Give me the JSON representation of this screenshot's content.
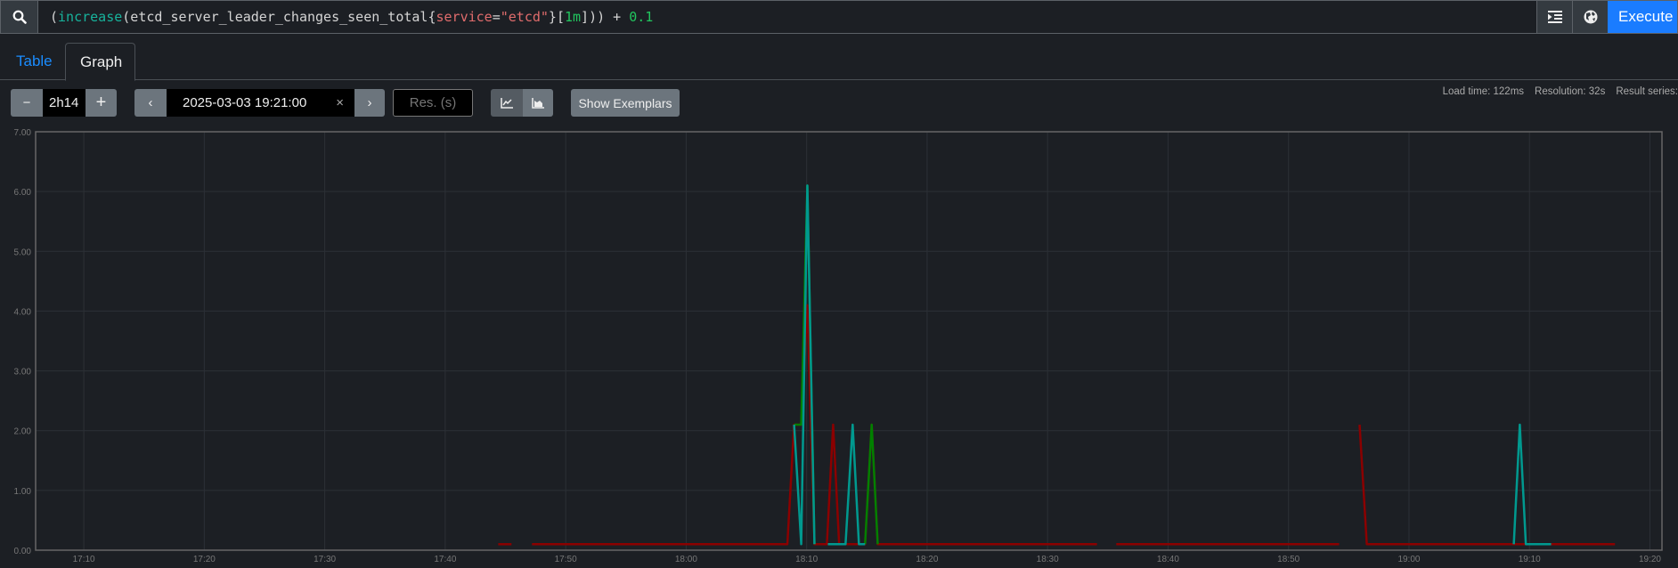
{
  "query": {
    "open": "(",
    "fn": "increase",
    "metric": "(etcd_server_leader_changes_seen_total{",
    "label_key": "service",
    "eq": "=",
    "label_val": "\"etcd\"",
    "close_brace": "}[",
    "range": "1m",
    "tail": "])) + ",
    "num": "0.1"
  },
  "buttons": {
    "execute": "Execute",
    "format_icon": "format-indent-icon",
    "explain_icon": "globe-icon"
  },
  "tabs": [
    {
      "label": "Table",
      "active": false
    },
    {
      "label": "Graph",
      "active": true
    }
  ],
  "stats": {
    "load_time": "Load time: 122ms",
    "resolution": "Resolution: 32s",
    "result_series": "Result series:"
  },
  "toolbar": {
    "range": "2h14",
    "end_time": "2025-03-03 19:21:00",
    "res_placeholder": "Res. (s)",
    "show_exemplars": "Show Exemplars",
    "minus": "−",
    "plus": "+",
    "clear": "×"
  },
  "colors": {
    "accent": "#1a7cff",
    "series": [
      "#8b0000",
      "#008000",
      "#00998f"
    ]
  },
  "chart_data": {
    "type": "line",
    "x_start": "17:06",
    "x_end_minutes": 135,
    "ylim": [
      0,
      7
    ],
    "yticks": [
      "0.00",
      "1.00",
      "2.00",
      "3.00",
      "4.00",
      "5.00",
      "6.00",
      "7.00"
    ],
    "xticks": [
      {
        "label": "17:10",
        "min": 4
      },
      {
        "label": "17:20",
        "min": 14
      },
      {
        "label": "17:30",
        "min": 24
      },
      {
        "label": "17:40",
        "min": 34
      },
      {
        "label": "17:50",
        "min": 44
      },
      {
        "label": "18:00",
        "min": 54
      },
      {
        "label": "18:10",
        "min": 64
      },
      {
        "label": "18:20",
        "min": 74
      },
      {
        "label": "18:30",
        "min": 84
      },
      {
        "label": "18:40",
        "min": 94
      },
      {
        "label": "18:50",
        "min": 104
      },
      {
        "label": "19:00",
        "min": 114
      },
      {
        "label": "19:10",
        "min": 124
      },
      {
        "label": "19:20",
        "min": 134
      }
    ],
    "grid": true,
    "series": [
      {
        "name": "series-red",
        "color": "#8b0000",
        "segments": [
          [
            [
              38.4,
              0.1
            ],
            [
              39.5,
              0.1
            ]
          ],
          [
            [
              41.2,
              0.1
            ],
            [
              62.4,
              0.1
            ],
            [
              62.96,
              2.1
            ],
            [
              63.55,
              2.1
            ],
            [
              64.06,
              4.1
            ],
            [
              64.65,
              0.1
            ],
            [
              65.68,
              0.1
            ],
            [
              66.2,
              2.1
            ],
            [
              66.7,
              0.1
            ],
            [
              68.85,
              0.1
            ],
            [
              69.4,
              2.1
            ],
            [
              69.9,
              0.1
            ],
            [
              88.1,
              0.1
            ]
          ],
          [
            [
              89.7,
              0.1
            ],
            [
              108.2,
              0.1
            ]
          ],
          [
            [
              109.9,
              2.1
            ],
            [
              110.5,
              0.1
            ],
            [
              131.1,
              0.1
            ]
          ]
        ]
      },
      {
        "name": "series-green",
        "color": "#008000",
        "segments": [
          [
            [
              62.96,
              2.1
            ],
            [
              63.55,
              2.1
            ],
            [
              64.06,
              6.1
            ],
            [
              64.65,
              0.1
            ]
          ],
          [
            [
              68.85,
              0.1
            ],
            [
              69.4,
              2.1
            ],
            [
              69.9,
              0.1
            ]
          ]
        ]
      },
      {
        "name": "series-teal",
        "color": "#00998f",
        "segments": [
          [
            [
              62.96,
              2.1
            ],
            [
              63.55,
              0.1
            ],
            [
              64.06,
              6.1
            ],
            [
              64.65,
              0.1
            ]
          ],
          [
            [
              65.76,
              0.1
            ],
            [
              67.23,
              0.1
            ],
            [
              67.82,
              2.1
            ],
            [
              68.34,
              0.1
            ],
            [
              68.85,
              0.1
            ]
          ],
          [
            [
              122.7,
              0.1
            ],
            [
              123.2,
              2.1
            ],
            [
              123.7,
              0.1
            ],
            [
              125.8,
              0.1
            ]
          ]
        ]
      }
    ]
  }
}
